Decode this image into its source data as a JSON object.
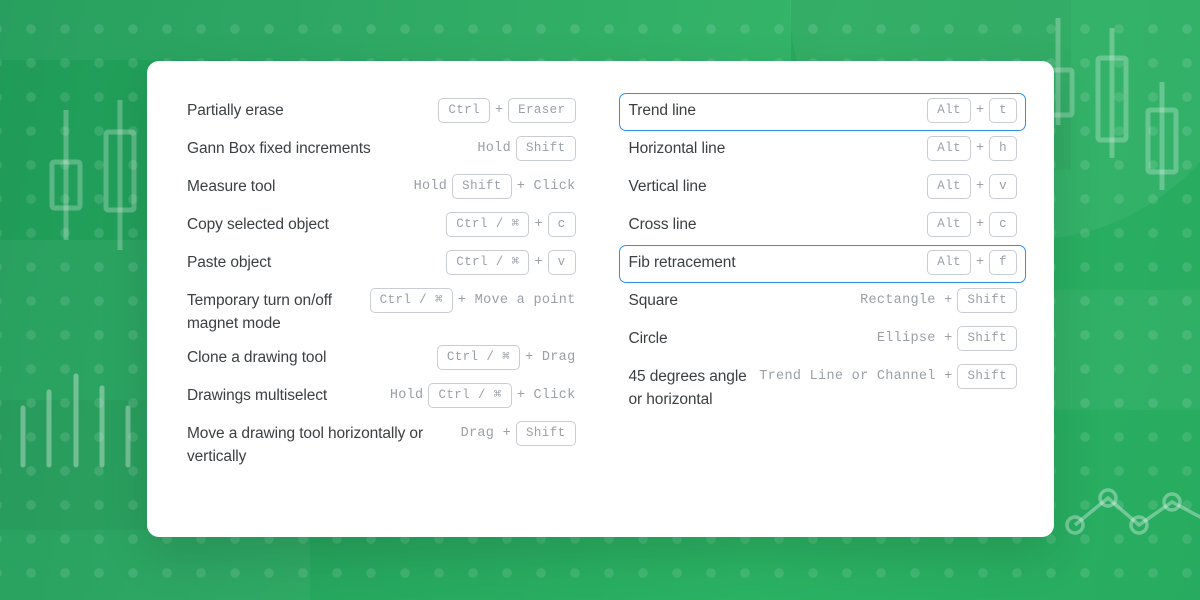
{
  "theme": {
    "background_green_dark": "#1f9b57",
    "background_green_light": "#2bb263",
    "card_background": "#ffffff",
    "highlight_border": "#2f90e8",
    "label_color": "#3c4043",
    "key_text_color": "#9aa0a6",
    "key_border_color": "#c9cdd1"
  },
  "left_column": [
    {
      "label": "Partially erase",
      "highlight": false,
      "parts": [
        {
          "kind": "key",
          "text": "Ctrl"
        },
        {
          "kind": "plus",
          "text": "+"
        },
        {
          "kind": "key",
          "text": "Eraser"
        }
      ]
    },
    {
      "label": "Gann Box fixed increments",
      "highlight": false,
      "parts": [
        {
          "kind": "text",
          "text": "Hold"
        },
        {
          "kind": "key",
          "text": "Shift"
        }
      ]
    },
    {
      "label": "Measure tool",
      "highlight": false,
      "parts": [
        {
          "kind": "text",
          "text": "Hold"
        },
        {
          "kind": "key",
          "text": "Shift"
        },
        {
          "kind": "text",
          "text": "+ Click"
        }
      ]
    },
    {
      "label": "Copy selected object",
      "highlight": false,
      "parts": [
        {
          "kind": "key",
          "text": "Ctrl / ⌘"
        },
        {
          "kind": "plus",
          "text": "+"
        },
        {
          "kind": "key",
          "text": "c"
        }
      ]
    },
    {
      "label": "Paste object",
      "highlight": false,
      "parts": [
        {
          "kind": "key",
          "text": "Ctrl / ⌘"
        },
        {
          "kind": "plus",
          "text": "+"
        },
        {
          "kind": "key",
          "text": "v"
        }
      ]
    },
    {
      "label": "Temporary turn on/off magnet mode",
      "highlight": false,
      "parts": [
        {
          "kind": "key",
          "text": "Ctrl / ⌘"
        },
        {
          "kind": "text",
          "text": "+ Move a point"
        }
      ]
    },
    {
      "label": "Clone a drawing tool",
      "highlight": false,
      "parts": [
        {
          "kind": "key",
          "text": "Ctrl / ⌘"
        },
        {
          "kind": "text",
          "text": "+ Drag"
        }
      ]
    },
    {
      "label": "Drawings multiselect",
      "highlight": false,
      "parts": [
        {
          "kind": "text",
          "text": "Hold"
        },
        {
          "kind": "key",
          "text": "Ctrl / ⌘"
        },
        {
          "kind": "text",
          "text": "+ Click"
        }
      ]
    },
    {
      "label": "Move a drawing tool horizontally or vertically",
      "highlight": false,
      "parts": [
        {
          "kind": "text",
          "text": "Drag +"
        },
        {
          "kind": "key",
          "text": "Shift"
        }
      ]
    }
  ],
  "right_column": [
    {
      "label": "Trend line",
      "highlight": true,
      "parts": [
        {
          "kind": "key",
          "text": "Alt"
        },
        {
          "kind": "plus",
          "text": "+"
        },
        {
          "kind": "key",
          "text": "t"
        }
      ]
    },
    {
      "label": "Horizontal line",
      "highlight": false,
      "parts": [
        {
          "kind": "key",
          "text": "Alt"
        },
        {
          "kind": "plus",
          "text": "+"
        },
        {
          "kind": "key",
          "text": "h"
        }
      ]
    },
    {
      "label": "Vertical line",
      "highlight": false,
      "parts": [
        {
          "kind": "key",
          "text": "Alt"
        },
        {
          "kind": "plus",
          "text": "+"
        },
        {
          "kind": "key",
          "text": "v"
        }
      ]
    },
    {
      "label": "Cross line",
      "highlight": false,
      "parts": [
        {
          "kind": "key",
          "text": "Alt"
        },
        {
          "kind": "plus",
          "text": "+"
        },
        {
          "kind": "key",
          "text": "c"
        }
      ]
    },
    {
      "label": "Fib retracement",
      "highlight": true,
      "parts": [
        {
          "kind": "key",
          "text": "Alt"
        },
        {
          "kind": "plus",
          "text": "+"
        },
        {
          "kind": "key",
          "text": "f"
        }
      ]
    },
    {
      "label": "Square",
      "highlight": false,
      "parts": [
        {
          "kind": "text",
          "text": "Rectangle +"
        },
        {
          "kind": "key",
          "text": "Shift"
        }
      ]
    },
    {
      "label": "Circle",
      "highlight": false,
      "parts": [
        {
          "kind": "text",
          "text": "Ellipse +"
        },
        {
          "kind": "key",
          "text": "Shift"
        }
      ]
    },
    {
      "label": "45 degrees angle or horizontal",
      "highlight": false,
      "parts": [
        {
          "kind": "text",
          "text": "Trend Line or Channel +"
        },
        {
          "kind": "key",
          "text": "Shift"
        }
      ]
    }
  ],
  "background": {
    "decorations": [
      "candlestick-chart-left",
      "bar-chart-bottom-left",
      "candlestick-chart-top-right",
      "line-chart-bottom-right",
      "dot-grid-pattern",
      "large-circle-top-right"
    ]
  }
}
